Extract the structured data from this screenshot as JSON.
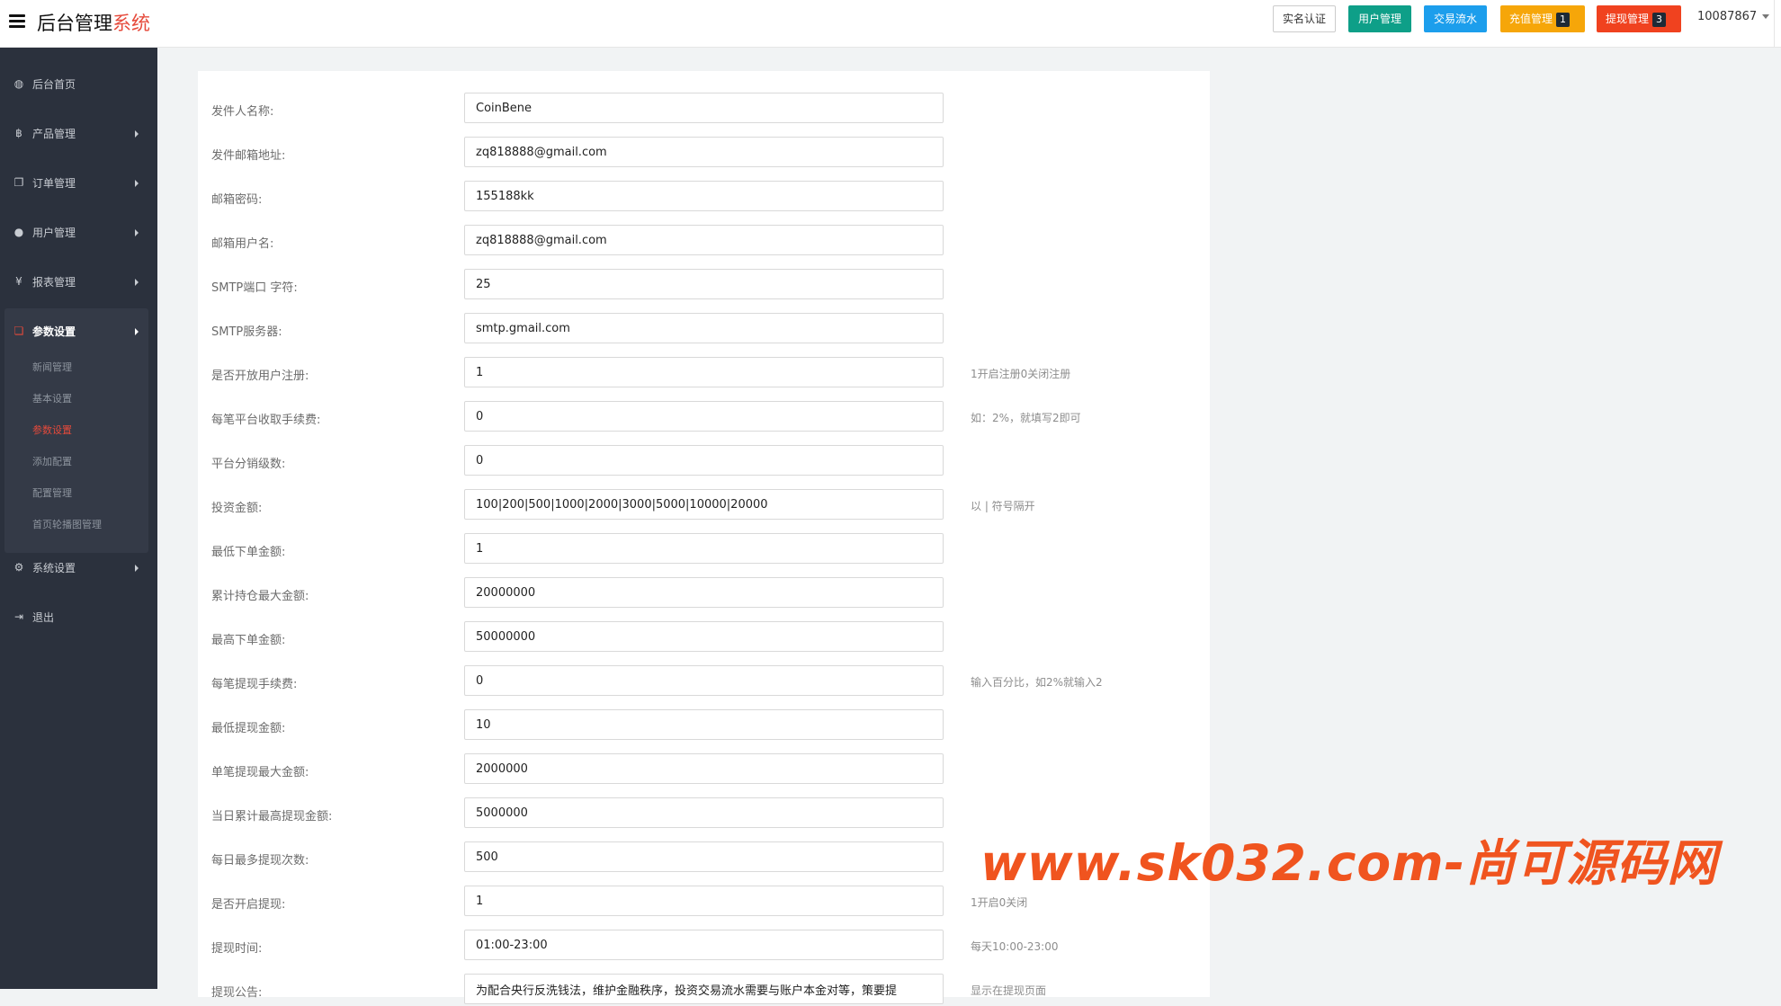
{
  "header": {
    "brand_main": "后台管理",
    "brand_accent": "系统",
    "buttons": {
      "verify": "实名认证",
      "users": "用户管理",
      "trade": "交易流水",
      "recharge": "充值管理",
      "recharge_count": "1",
      "withdraw": "提现管理",
      "withdraw_count": "3"
    },
    "user_id": "10087867"
  },
  "sidebar": {
    "items": [
      {
        "label": "后台首页",
        "icon": "dashboard-icon",
        "glyph": "◍"
      },
      {
        "label": "产品管理",
        "icon": "bitcoin-icon",
        "glyph": "฿"
      },
      {
        "label": "订单管理",
        "icon": "copy-icon",
        "glyph": "❐"
      },
      {
        "label": "用户管理",
        "icon": "user-icon",
        "glyph": "●"
      },
      {
        "label": "报表管理",
        "icon": "yen-icon",
        "glyph": "¥"
      },
      {
        "label": "参数设置",
        "icon": "file-icon",
        "glyph": "❏"
      },
      {
        "label": "系统设置",
        "icon": "cogs-icon",
        "glyph": "⚙"
      },
      {
        "label": "退出",
        "icon": "sign-out-icon",
        "glyph": "⇥"
      }
    ],
    "sub_items": [
      "新闻管理",
      "基本设置",
      "参数设置",
      "添加配置",
      "配置管理",
      "首页轮播图管理"
    ]
  },
  "form": {
    "rows": [
      {
        "label": "发件人名称:",
        "value": "CoinBene",
        "hint": ""
      },
      {
        "label": "发件邮箱地址:",
        "value": "zq818888@gmail.com",
        "hint": ""
      },
      {
        "label": "邮箱密码:",
        "value": "155188kk",
        "hint": ""
      },
      {
        "label": "邮箱用户名:",
        "value": "zq818888@gmail.com",
        "hint": ""
      },
      {
        "label": "SMTP端口 字符:",
        "value": "25",
        "hint": ""
      },
      {
        "label": "SMTP服务器:",
        "value": "smtp.gmail.com",
        "hint": ""
      },
      {
        "label": "是否开放用户注册:",
        "value": "1",
        "hint": "1开启注册0关闭注册"
      },
      {
        "label": "每笔平台收取手续费:",
        "value": "0",
        "hint": "如：2%，就填写2即可"
      },
      {
        "label": "平台分销级数:",
        "value": "0",
        "hint": ""
      },
      {
        "label": "投资金额:",
        "value": "100|200|500|1000|2000|3000|5000|10000|20000",
        "hint": "以 | 符号隔开"
      },
      {
        "label": "最低下单金额:",
        "value": "1",
        "hint": ""
      },
      {
        "label": "累计持仓最大金额:",
        "value": "20000000",
        "hint": ""
      },
      {
        "label": "最高下单金额:",
        "value": "50000000",
        "hint": ""
      },
      {
        "label": "每笔提现手续费:",
        "value": "0",
        "hint": "输入百分比，如2%就输入2"
      },
      {
        "label": "最低提现金额:",
        "value": "10",
        "hint": ""
      },
      {
        "label": "单笔提现最大金额:",
        "value": "2000000",
        "hint": ""
      },
      {
        "label": "当日累计最高提现金额:",
        "value": "5000000",
        "hint": ""
      },
      {
        "label": "每日最多提现次数:",
        "value": "500",
        "hint": ""
      },
      {
        "label": "是否开启提现:",
        "value": "1",
        "hint": "1开启0关闭"
      },
      {
        "label": "提现时间:",
        "value": "01:00-23:00",
        "hint": "每天10:00-23:00"
      },
      {
        "label": "提现公告:",
        "value": "为配合央行反洗钱法，维护金融秩序，投资交易流水需要与账户本金对等，策要提",
        "hint": "显示在提现页面"
      }
    ]
  },
  "watermark": "www.sk032.com-尚可源码网",
  "colors": {
    "sidebar_bg": "#2b313d",
    "accent_red": "#e64a3b",
    "users_btn": "#0e9f88",
    "trade_btn": "#1c9eec",
    "recharge_btn": "#f6a609",
    "withdraw_btn": "#f0421f",
    "watermark": "#f0541f"
  }
}
